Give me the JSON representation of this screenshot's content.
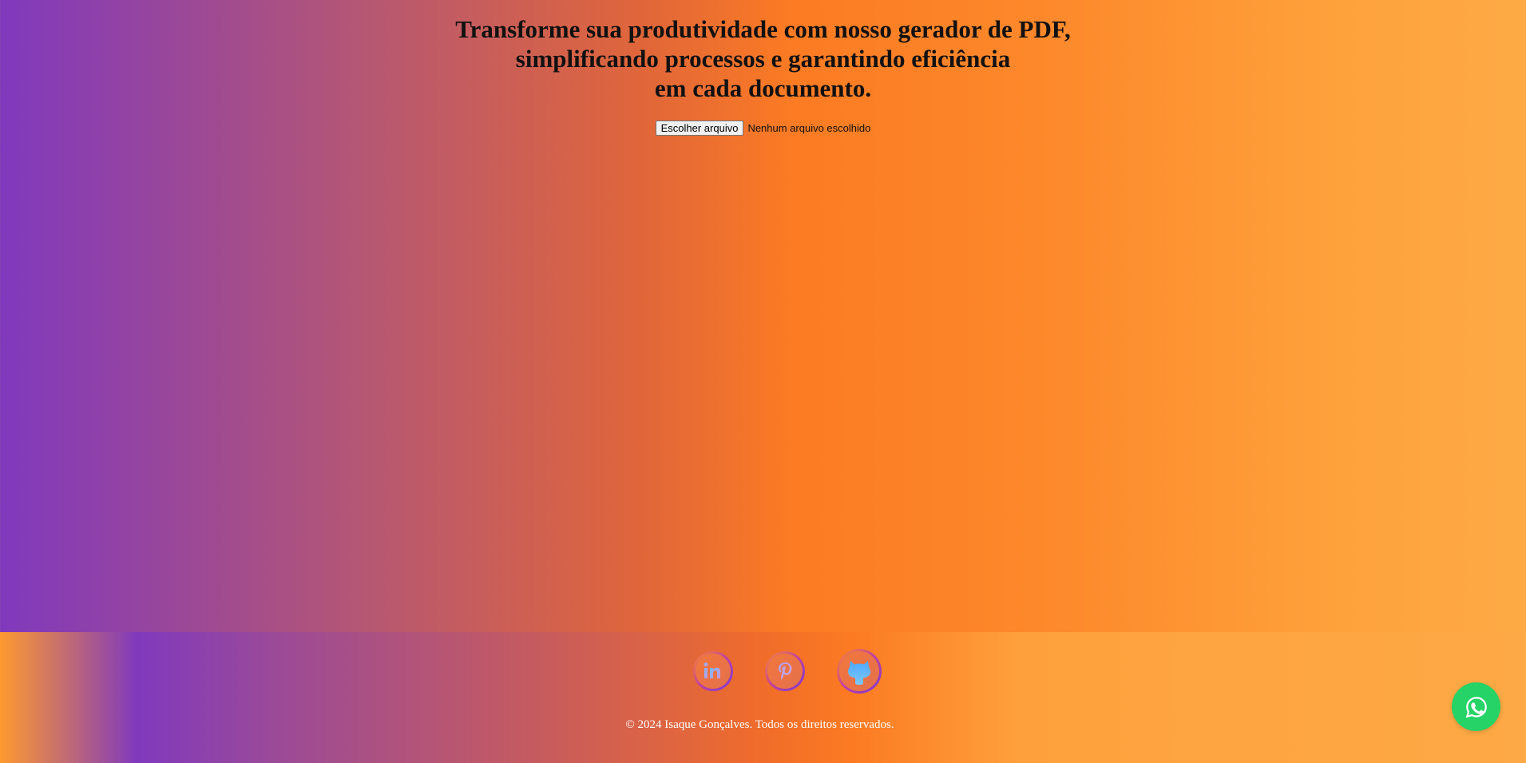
{
  "hero": {
    "headline_line1": "Transforme sua produtividade com nosso gerador de PDF,",
    "headline_line2": "simplificando processos e garantindo eficiência",
    "headline_line3": "em cada documento."
  },
  "file_input": {
    "button_label": "Escolher arquivo",
    "status_text": "Nenhum arquivo escolhido"
  },
  "footer": {
    "socials": [
      {
        "icon": "linkedin-icon"
      },
      {
        "icon": "pinterest-icon"
      },
      {
        "icon": "github-icon"
      }
    ],
    "copyright": "© 2024 Isaque Gonçalves. Todos os direitos reservados."
  },
  "floating": {
    "icon": "whatsapp-icon",
    "color": "#25d366"
  }
}
